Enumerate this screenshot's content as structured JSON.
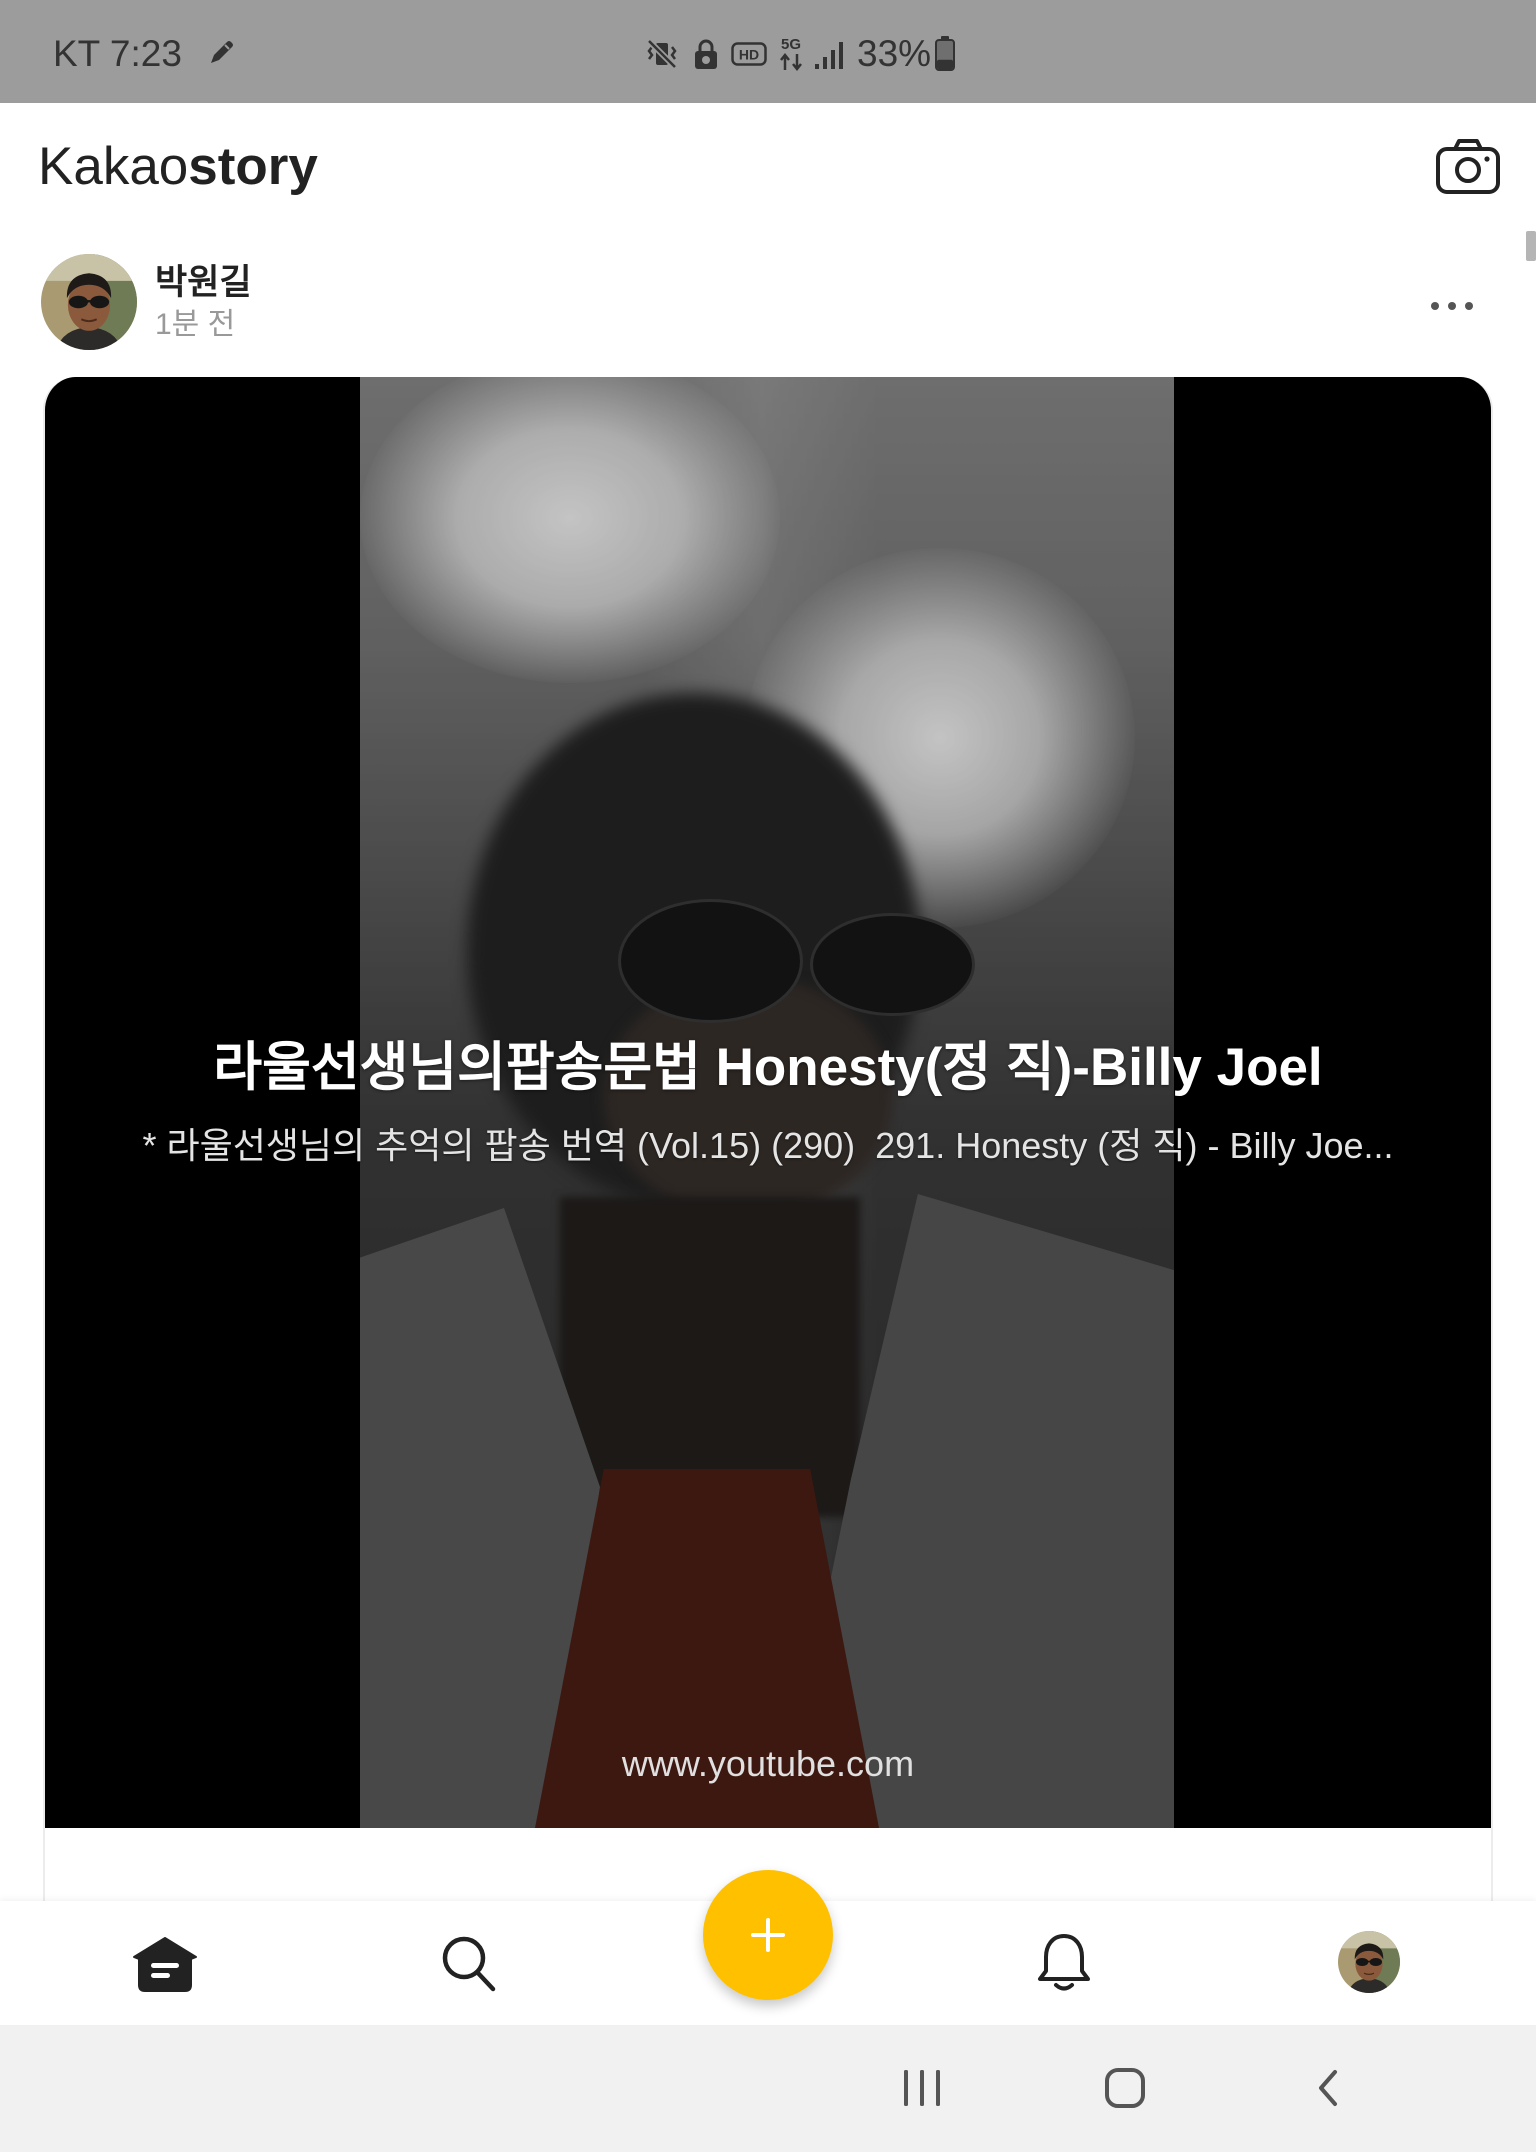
{
  "status_bar": {
    "time": "KT 7:23",
    "hd_label": "HD",
    "network_label": "5G",
    "battery": "33%",
    "icons": [
      "pen-icon",
      "vibrate-off-icon",
      "lock-icon",
      "hd-icon",
      "5g-icon",
      "signal-icon",
      "battery-icon"
    ]
  },
  "header": {
    "logo_light": "Kakao",
    "logo_bold": "story",
    "camera_icon": "camera-icon"
  },
  "post": {
    "author": "박원길",
    "time": "1분 전",
    "more_icon": "more-icon",
    "link_preview": {
      "title": "라울선생님의팝송문법 Honesty(정 직)-Billy Joel",
      "description": "* 라울선생님의 추억의 팝송 번역 (Vol.15) (290)  291. Honesty (정 직) - Billy Joe...",
      "domain": "www.youtube.com"
    }
  },
  "bottom_nav": {
    "items": [
      {
        "icon": "home-icon"
      },
      {
        "icon": "search-icon"
      },
      {
        "icon": "add-icon"
      },
      {
        "icon": "bell-icon"
      },
      {
        "icon": "profile-avatar"
      }
    ]
  },
  "system_nav": {
    "items": [
      {
        "icon": "recents-icon"
      },
      {
        "icon": "home-button-icon"
      },
      {
        "icon": "back-icon"
      }
    ]
  },
  "colors": {
    "status_bar": "#9c9c9c",
    "accent": "#ffc000",
    "text": "#222222",
    "muted": "#999999",
    "system_nav": "#f1f1f1"
  }
}
